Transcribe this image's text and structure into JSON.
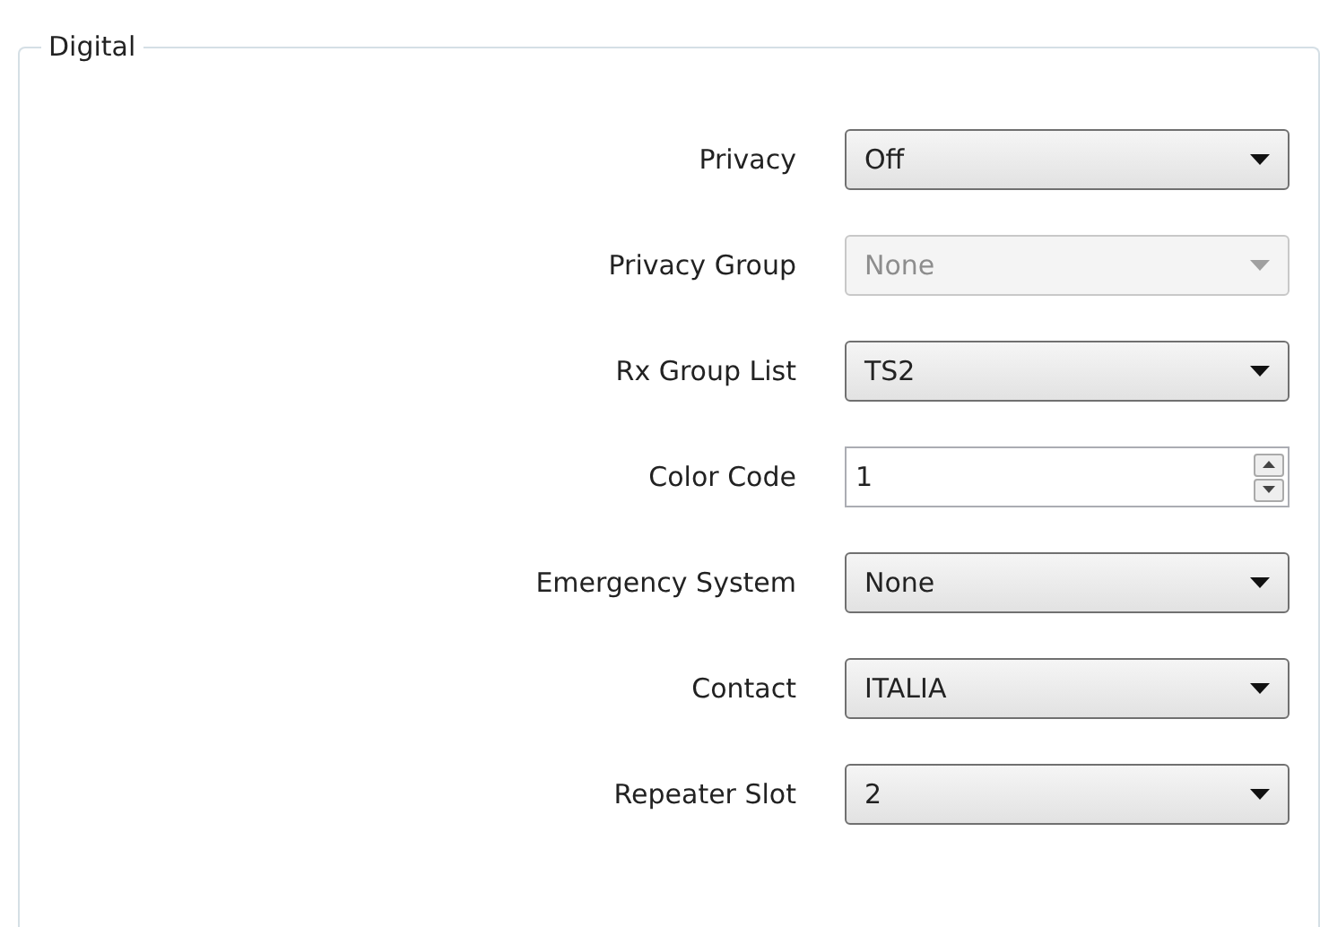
{
  "group": {
    "title": "Digital"
  },
  "fields": [
    {
      "label": "Privacy",
      "kind": "dropdown",
      "value": "Off",
      "disabled": false
    },
    {
      "label": "Privacy Group",
      "kind": "dropdown",
      "value": "None",
      "disabled": true
    },
    {
      "label": "Rx Group List",
      "kind": "dropdown",
      "value": "TS2",
      "disabled": false
    },
    {
      "label": "Color Code",
      "kind": "spinner",
      "value": "1",
      "disabled": false
    },
    {
      "label": "Emergency System",
      "kind": "dropdown",
      "value": "None",
      "disabled": false
    },
    {
      "label": "Contact",
      "kind": "dropdown",
      "value": "ITALIA",
      "disabled": false
    },
    {
      "label": "Repeater Slot",
      "kind": "dropdown",
      "value": "2",
      "disabled": false
    }
  ]
}
